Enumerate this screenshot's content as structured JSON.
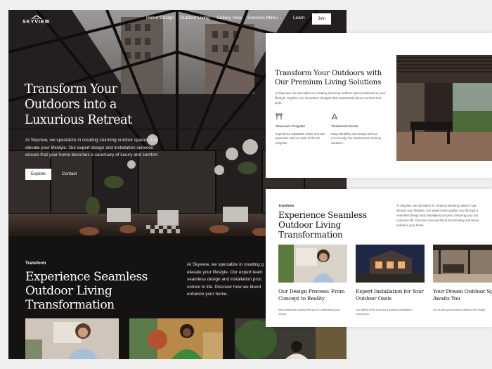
{
  "nav": {
    "logo": "SKYVIEW",
    "links": [
      "Home Design",
      "Outdoor Living",
      "Gallery View",
      "Services Menu",
      "Learn"
    ],
    "join": "Join"
  },
  "hero": {
    "title": "Transform Your Outdoors into a Luxurious Retreat",
    "description": "At Skyview, we specialize in creating stunning outdoor spaces that elevate your lifestyle. Our expert design and installation services ensure that your home becomes a sanctuary of luxury and comfort.",
    "explore": "Explore",
    "contact": "Contact"
  },
  "dark_section": {
    "eyebrow": "Transform",
    "title": "Experience Seamless Outdoor Living Transformation",
    "description": "At Skyview, we specialize in creating g\nelevate your lifestyle. Our expert team\nseamless design and installation proc\ncomes to life. Discover how we blend\nenhance your home."
  },
  "card1": {
    "title": "Transform Your Outdoors with Our Premium Living Solutions",
    "description": "At Skyview, we specialize in creating stunning outdoor spaces tailored to your lifestyle. Explore our innovative designs that seamlessly blend comfort and style.",
    "features": [
      {
        "icon": "pergola-icon",
        "title": "Sleeveure Pergolas",
        "desc": "Experience adjustable shade and rain protection with our state-of-the-art pergolas."
      },
      {
        "icon": "deck-icon",
        "title": "Timbertech Decks",
        "desc": "Enjoy durability and beauty with our eco-friendly, low-maintenance decking solutions."
      }
    ]
  },
  "card2": {
    "eyebrow": "Transform",
    "title": "Experience Seamless Outdoor Living Transformation",
    "description": "At Skyview, we specialize in creating stunning outdoor spa\nelevate your lifestyle. Our expert team guides you through a\nseamless design and installation process, ensuring your visi\ncomes to life. Discover how we blend functionality and beaut\nenhance your home.",
    "services": [
      {
        "title": "Our Design Process: From Concept to Reality",
        "desc": "We collaborate closely with you to understand your needs."
      },
      {
        "title": "Expert Installation for Your Outdoor Oasis",
        "desc": "Our skilled team ensures a flawless installation experience."
      },
      {
        "title": "Your Dream Outdoor Spa Awaits You",
        "desc": "Let us turn your outdoor dreams into reality"
      }
    ]
  }
}
